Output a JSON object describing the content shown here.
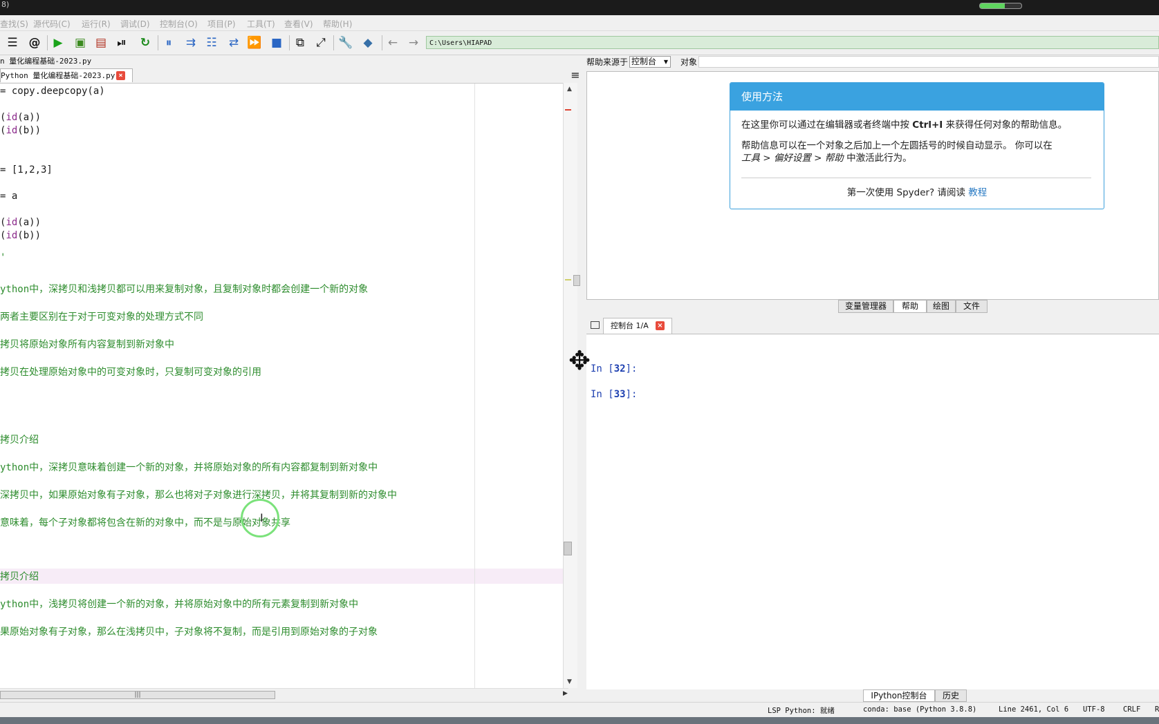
{
  "top_strip": {
    "text": "8)",
    "progress": 0.6
  },
  "menu": [
    "查找(S)",
    "源代码(C)",
    "运行(R)",
    "调试(D)",
    "控制台(O)",
    "项目(P)",
    "工具(T)",
    "查看(V)",
    "帮助(H)"
  ],
  "toolbar": {
    "path": "C:\\Users\\HIAPAD"
  },
  "editor": {
    "window_title": "n 量化编程基础-2023.py",
    "tab_label": "Python 量化编程基础-2023.py",
    "tab_close": "×",
    "lines": [
      "= copy.deepcopy(a)",
      "(id(a))",
      "(id(b))",
      "= [1,2,3]",
      "= a",
      "(id(a))",
      "(id(b))",
      "'",
      "ython中，深拷贝和浅拷贝都可以用来复制对象，且复制对象时都会创建一个新的对象",
      "两者主要区别在于对于可变对象的处理方式不同",
      "拷贝将原始对象所有内容复制到新对象中",
      "拷贝在处理原始对象中的可变对象时，只复制可变对象的引用",
      "拷贝介绍",
      "ython中，深拷贝意味着创建一个新的对象，并将原始对象的所有内容都复制到新对象中",
      "深拷贝中，如果原始对象有子对象，那么也将对子对象进行深拷贝，并将其复制到新的对象中",
      "意味着，每个子对象都将包含在新的对象中，而不是与原始对象共享",
      "拷贝介绍",
      "ython中，浅拷贝将创建一个新的对象，并将原始对象中的所有元素复制到新对象中",
      "果原始对象有子对象，那么在浅拷贝中，子对象将不复制，而是引用到原始对象的子对象"
    ]
  },
  "help": {
    "source_label": "帮助来源于",
    "source_value": "控制台",
    "object_label": "对象",
    "card_title": "使用方法",
    "para1_a": "在这里你可以通过在编辑器或者终端中按 ",
    "para1_key": "Ctrl+I",
    "para1_b": " 来获得任何对象的帮助信息。",
    "para2_a": "帮助信息可以在一个对象之后加上一个左圆括号的时候自动显示。 你可以在",
    "para2_menu": "工具 > 偏好设置 > 帮助",
    "para2_b": " 中激活此行为。",
    "footer_text": "第一次使用 Spyder? 请阅读 ",
    "footer_link": "教程"
  },
  "pane_tabs": [
    "变量管理器",
    "帮助",
    "绘图",
    "文件"
  ],
  "console": {
    "tab_label": "控制台 1/A",
    "tab_close": "×",
    "prompts": [
      {
        "prefix": "In [",
        "num": "32",
        "suffix": "]:"
      },
      {
        "prefix": "In [",
        "num": "33",
        "suffix": "]:"
      }
    ],
    "bottom_tabs": [
      "IPython控制台",
      "历史"
    ]
  },
  "status": {
    "lsp": "LSP Python: 就绪",
    "conda": "conda: base (Python 3.8.8)",
    "position": "Line 2461, Col 6",
    "encoding": "UTF-8",
    "eol": "CRLF",
    "extra": "R"
  },
  "colors": {
    "accent": "#3aa2e0",
    "comment": "#2d8c2d",
    "builtin": "#8b2a8b",
    "prompt": "#1d3fb0"
  }
}
